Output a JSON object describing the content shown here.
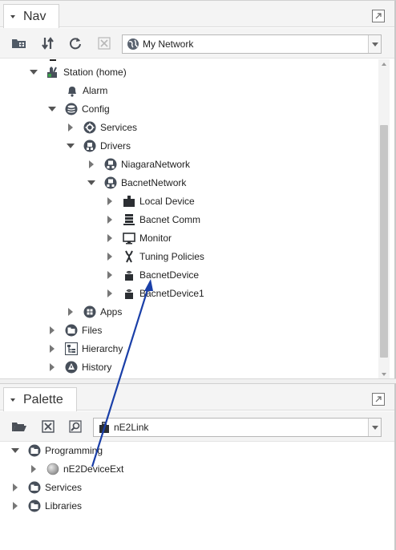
{
  "nav": {
    "title": "Nav",
    "toolbar": {
      "buttons": [
        "new-folder-icon",
        "sync-arrows-icon",
        "refresh-icon",
        "close-icon"
      ],
      "dropdown_value": "My Network",
      "dropdown_icon": "globe-icon"
    },
    "tree": [
      {
        "label": "Station (home)",
        "icon": "station-icon",
        "toggle": "expanded"
      },
      {
        "label": "Alarm",
        "icon": "bell-icon",
        "toggle": "none"
      },
      {
        "label": "Config",
        "icon": "database-icon",
        "toggle": "expanded"
      },
      {
        "label": "Services",
        "icon": "services-gear-icon",
        "toggle": "collapsed"
      },
      {
        "label": "Drivers",
        "icon": "drivers-icon",
        "toggle": "expanded"
      },
      {
        "label": "NiagaraNetwork",
        "icon": "network-icon",
        "toggle": "collapsed"
      },
      {
        "label": "BacnetNetwork",
        "icon": "network-icon",
        "toggle": "expanded"
      },
      {
        "label": "Local Device",
        "icon": "local-device-icon",
        "toggle": "collapsed"
      },
      {
        "label": "Bacnet Comm",
        "icon": "comm-stack-icon",
        "toggle": "collapsed"
      },
      {
        "label": "Monitor",
        "icon": "monitor-icon",
        "toggle": "collapsed"
      },
      {
        "label": "Tuning Policies",
        "icon": "wrench-icon",
        "toggle": "collapsed"
      },
      {
        "label": "BacnetDevice",
        "icon": "device-icon",
        "toggle": "collapsed"
      },
      {
        "label": "BacnetDevice1",
        "icon": "device-icon",
        "toggle": "collapsed"
      },
      {
        "label": "Apps",
        "icon": "apps-icon",
        "toggle": "collapsed"
      },
      {
        "label": "Files",
        "icon": "files-icon",
        "toggle": "collapsed"
      },
      {
        "label": "Hierarchy",
        "icon": "hierarchy-icon",
        "toggle": "collapsed"
      },
      {
        "label": "History",
        "icon": "history-icon",
        "toggle": "collapsed"
      }
    ]
  },
  "palette": {
    "title": "Palette",
    "toolbar": {
      "buttons": [
        "open-folder-icon",
        "close-palette-icon",
        "find-icon"
      ],
      "dropdown_value": "nE2Link",
      "dropdown_icon": "module-jar-icon"
    },
    "tree": [
      {
        "label": "Programming",
        "icon": "folder-round-icon",
        "toggle": "expanded"
      },
      {
        "label": "nE2DeviceExt",
        "icon": "component-ball-icon",
        "toggle": "collapsed"
      },
      {
        "label": "Services",
        "icon": "folder-round-icon",
        "toggle": "collapsed"
      },
      {
        "label": "Libraries",
        "icon": "folder-round-icon",
        "toggle": "collapsed"
      }
    ]
  },
  "colors": {
    "drag_arrow": "#1a3fa8",
    "pane_header": "#f4f4f4",
    "scrollbar_thumb": "#c6c6c6"
  }
}
